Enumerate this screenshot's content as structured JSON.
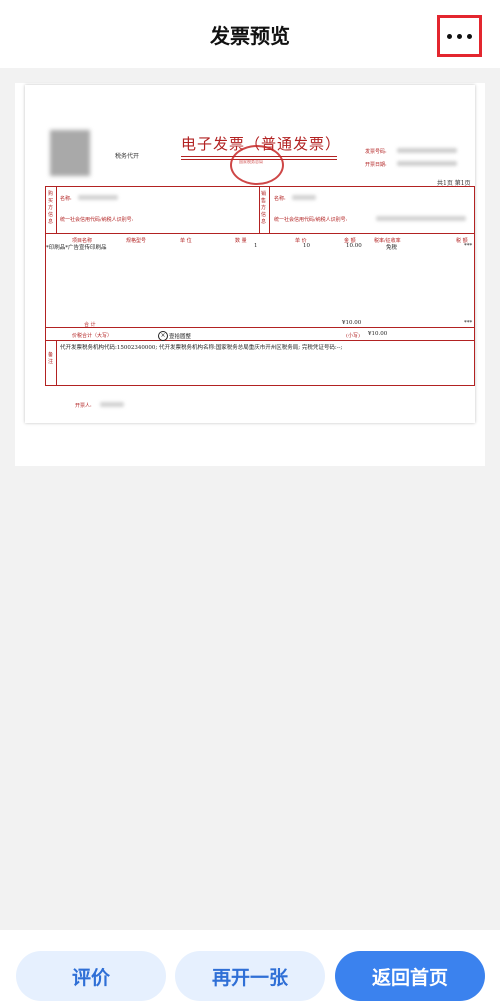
{
  "header": {
    "title": "发票预览",
    "more_icon": "more-dots-icon"
  },
  "invoice": {
    "agency": "税务代开",
    "title": "电子发票（普通发票）",
    "seal_text": "国家税务总局",
    "invoice_no_label": "发票号码:",
    "issue_date_label": "开票日期:",
    "page_info": "共1页 第1页",
    "buyer_side_label": "购买方信息",
    "seller_side_label": "销售方信息",
    "buyer_name_label": "名称:",
    "buyer_taxid_label": "统一社会信用代码/纳税人识别号:",
    "seller_name_label": "名称:",
    "seller_taxid_label": "统一社会信用代码/纳税人识别号:",
    "columns": [
      "项目名称",
      "规格型号",
      "单 位",
      "数 量",
      "单 价",
      "金 额",
      "税率/征收率",
      "税 额"
    ],
    "item": {
      "name": "*印刷品*广告宣传印刷品",
      "quantity": "1",
      "price": "10",
      "amount": "10.00",
      "tax_rate": "免税",
      "tax": "***"
    },
    "total_label": "合 计",
    "total_amount": "¥10.00",
    "total_tax": "***",
    "total_words_label": "价税合计（大写）",
    "total_words": "壹拾圆整",
    "total_small_label": "(小写)",
    "total_small": "¥10.00",
    "remark_label": "备注",
    "remark_text": "代开发票税务机构代码:15002340000;    代开发票税务机构名称:国家税务总局重庆市开州区税务局;    完税凭证号码:--;",
    "drawer_label": "开票人:"
  },
  "footer": {
    "rate_label": "评价",
    "reissue_label": "再开一张",
    "home_label": "返回首页"
  },
  "colors": {
    "primary": "#3b82ee",
    "light": "#e6f0fe",
    "invoice_red": "#b22222",
    "highlight": "#e3262e"
  }
}
